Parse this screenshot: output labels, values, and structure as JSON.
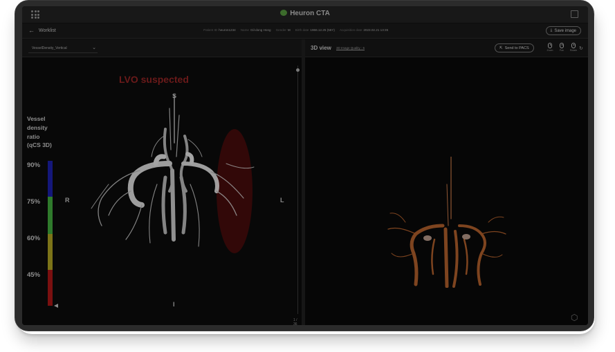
{
  "app": {
    "title": "Heuron CTA"
  },
  "infobar": {
    "back_label": "Worklist",
    "patient_fields": [
      {
        "label": "Patient ID",
        "value": "heuron1234"
      },
      {
        "label": "Name",
        "value": "Gil-dong Hong"
      },
      {
        "label": "Gender",
        "value": "M"
      },
      {
        "label": "Birth date",
        "value": "1966.12.25 (56Y)"
      },
      {
        "label": "Acquisition date",
        "value": "2023.02.21 13:35"
      }
    ],
    "save_label": "Save image"
  },
  "left_panel": {
    "select_value": "VesselDensity_Vertical",
    "alert": "LVO suspected",
    "orientation": {
      "top": "S",
      "bottom": "I",
      "left": "R",
      "right": "L"
    },
    "scale_title": [
      "Vessel",
      "density",
      "ratio",
      "(qCS 3D)"
    ],
    "ticks": [
      "90%",
      "75%",
      "60%",
      "45%"
    ],
    "scale_colors": [
      "#14177a",
      "#2f7a2c",
      "#7c7418",
      "#7a1010"
    ],
    "marker_value": "below 45%",
    "page_indicator": "1 / 36"
  },
  "right_panel": {
    "title": "3D view",
    "quality_label": "3D Image Quality : 6",
    "pacs_label": "Send to PACS",
    "controls": [
      "Zoom",
      "Pan",
      "Rotate"
    ]
  },
  "colors": {
    "accent_logo": "#3c6b2c",
    "vessel_gray": "#b8b8b8",
    "vessel_orange": "#8b4b22",
    "lvo_red": "#6b1a1a"
  }
}
